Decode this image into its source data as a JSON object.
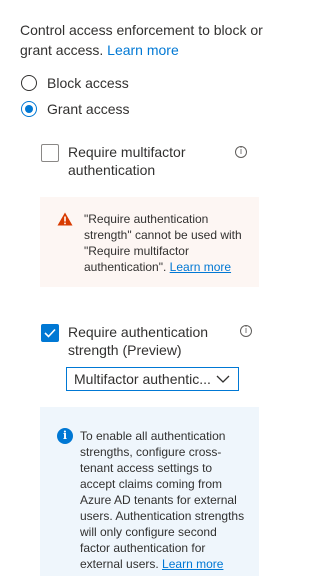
{
  "intro": {
    "text": "Control access enforcement to block or grant access.",
    "learn_more": "Learn more"
  },
  "access_options": [
    {
      "label": "Block access",
      "selected": false
    },
    {
      "label": "Grant access",
      "selected": true
    }
  ],
  "mfa": {
    "label": "Require multifactor authentication",
    "checked": false
  },
  "warning": {
    "text": "\"Require authentication strength\" cannot be used with \"Require multifactor authentication\".",
    "learn_more": "Learn more",
    "icon": "warning-icon"
  },
  "auth_strength": {
    "label": "Require authentication strength (Preview)",
    "checked": true,
    "dropdown_value": "Multifactor authentic..."
  },
  "info": {
    "text": "To enable all authentication strengths, configure cross-tenant access settings to accept claims coming from Azure AD tenants for external users. Authentication strengths will only configure second factor authentication for external users.",
    "learn_more": "Learn more",
    "icon": "info-icon"
  },
  "colors": {
    "accent": "#0078d4",
    "warning_bg": "#fdf6f3",
    "info_bg": "#eff6fc",
    "warning_icon": "#d83b01"
  }
}
